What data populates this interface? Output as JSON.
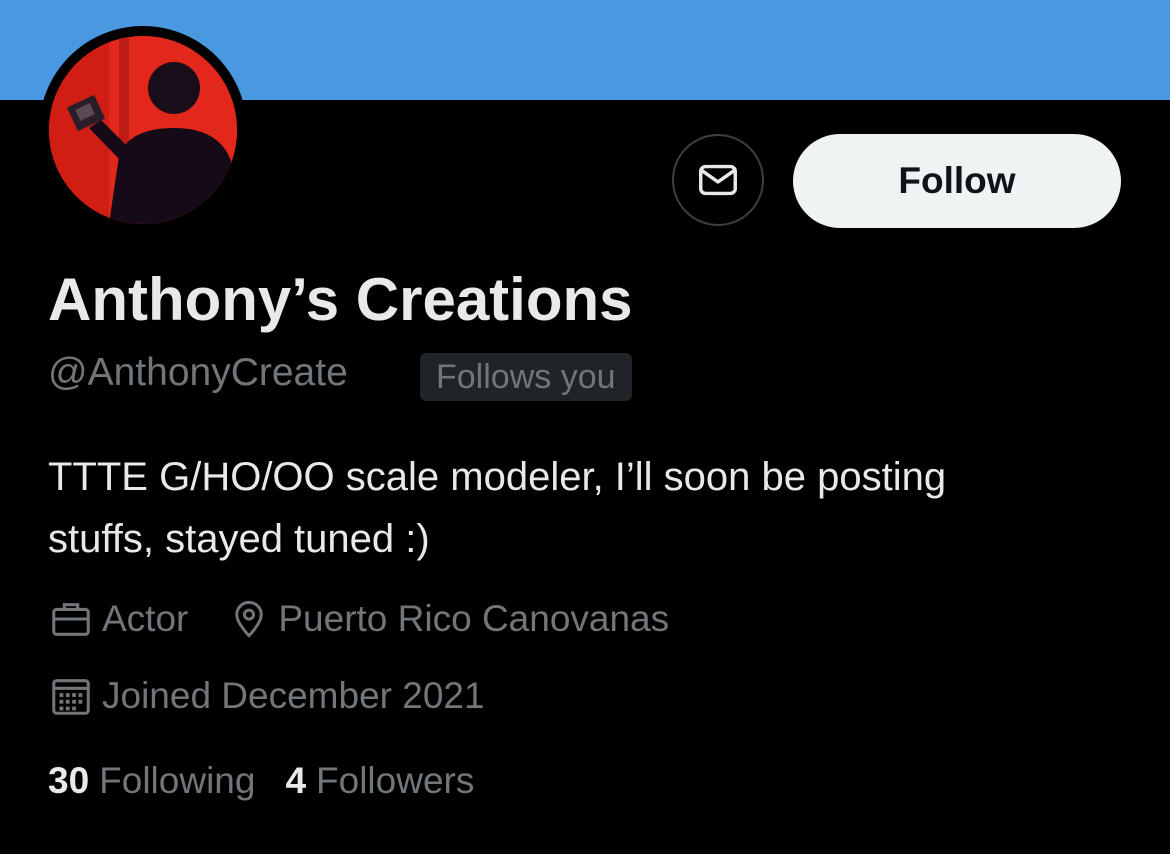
{
  "profile": {
    "display_name": "Anthony’s Creations",
    "handle": "@AnthonyCreate",
    "follows_you_badge": "Follows you",
    "bio_line1": "TTTE G/HO/OO scale modeler, I’ll soon be posting",
    "bio_line2": "stuffs, stayed tuned :)",
    "category": "Actor",
    "location": "Puerto Rico Canovanas",
    "joined": "Joined December 2021"
  },
  "actions": {
    "follow_label": "Follow",
    "message_icon": "envelope-icon"
  },
  "stats": {
    "following_count": "30",
    "following_label": "Following",
    "followers_count": "4",
    "followers_label": "Followers"
  },
  "icons": {
    "category": "briefcase-icon",
    "location": "map-pin-icon",
    "joined": "calendar-icon"
  },
  "colors": {
    "banner": "#4a98e0",
    "background": "#000000",
    "primary_text": "#e7e9ea",
    "secondary_text": "#71767b",
    "follow_button_bg": "#eff3f4",
    "avatar_bg": "#e2281c"
  }
}
